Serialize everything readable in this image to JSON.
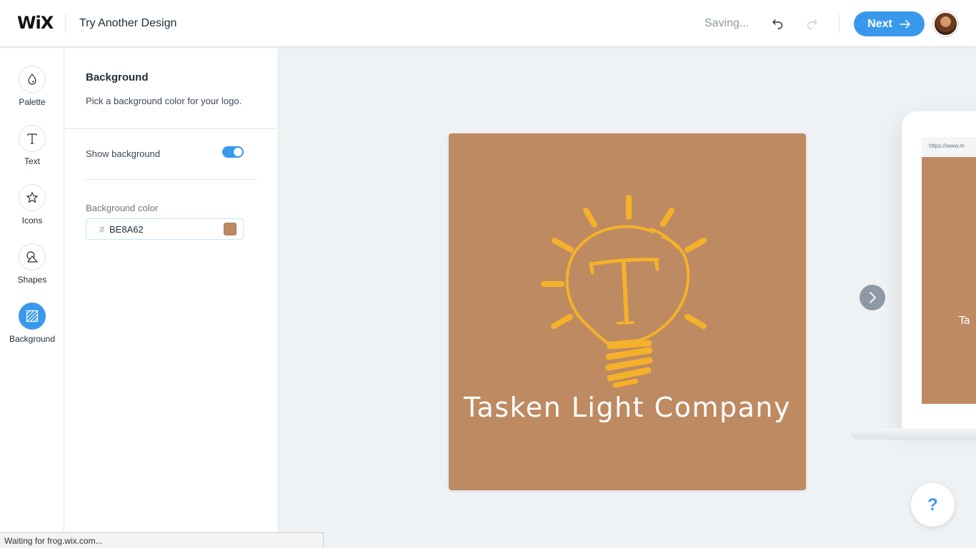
{
  "header": {
    "logo_text": "WiX",
    "try_another_label": "Try Another Design",
    "saving_text": "Saving...",
    "next_label": "Next"
  },
  "rail": {
    "items": [
      {
        "label": "Palette",
        "icon": "drop-icon",
        "active": false
      },
      {
        "label": "Text",
        "icon": "text-t-icon",
        "active": false
      },
      {
        "label": "Icons",
        "icon": "star-icon",
        "active": false
      },
      {
        "label": "Shapes",
        "icon": "shapes-icon",
        "active": true
      },
      {
        "label": "Background",
        "icon": "background-hatch-icon",
        "active": true
      }
    ]
  },
  "panel": {
    "title": "Background",
    "subtitle": "Pick a background color for your logo.",
    "show_background_label": "Show background",
    "show_background_on": true,
    "color_label": "Background color",
    "hash": "#",
    "color_value": "BE8A62"
  },
  "canvas": {
    "company_name": "Tasken Light Company",
    "logo_bg_color": "#BE8A62",
    "icon_color": "#F4B12A",
    "mockup_url": "https://www.m",
    "mockup_text": "Ta"
  },
  "help_label": "?",
  "status_text": "Waiting for frog.wix.com..."
}
